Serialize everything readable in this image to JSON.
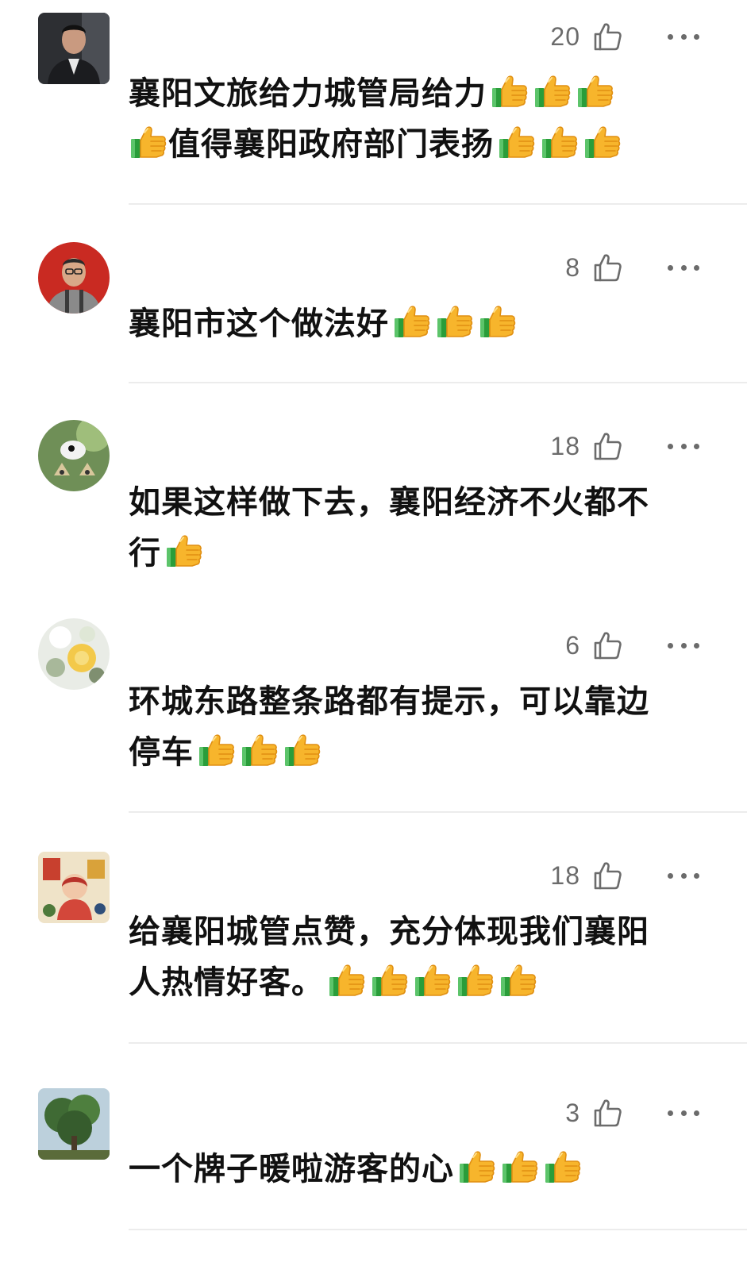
{
  "comments": [
    {
      "likes": "20",
      "text": "襄阳文旅给力城管局给力",
      "emoji_before": 3,
      "text2": "值得襄阳政府部门表扬",
      "emoji_after": 3
    },
    {
      "likes": "8",
      "text": "襄阳市这个做法好",
      "emoji_after": 3
    },
    {
      "likes": "18",
      "text": "如果这样做下去，襄阳经济不火都不行",
      "emoji_after": 1
    },
    {
      "likes": "6",
      "text": "环城东路整条路都有提示，可以靠边停车",
      "emoji_after": 3
    },
    {
      "likes": "18",
      "text": "给襄阳城管点赞，充分体现我们襄阳人热情好客。",
      "emoji_after": 5
    },
    {
      "likes": "3",
      "text": "一个牌子暖啦游客的心",
      "emoji_after": 3
    }
  ],
  "icons": {
    "like": "thumbs-up-outline-icon",
    "more": "more-dots-icon",
    "emoji": "thumbs-up-emoji-icon"
  },
  "colors": {
    "text": "#111111",
    "meta": "#6b6b6b",
    "divider": "#ececec",
    "emoji_hand": "#f7b52c",
    "emoji_cuff": "#2a9d3a"
  }
}
